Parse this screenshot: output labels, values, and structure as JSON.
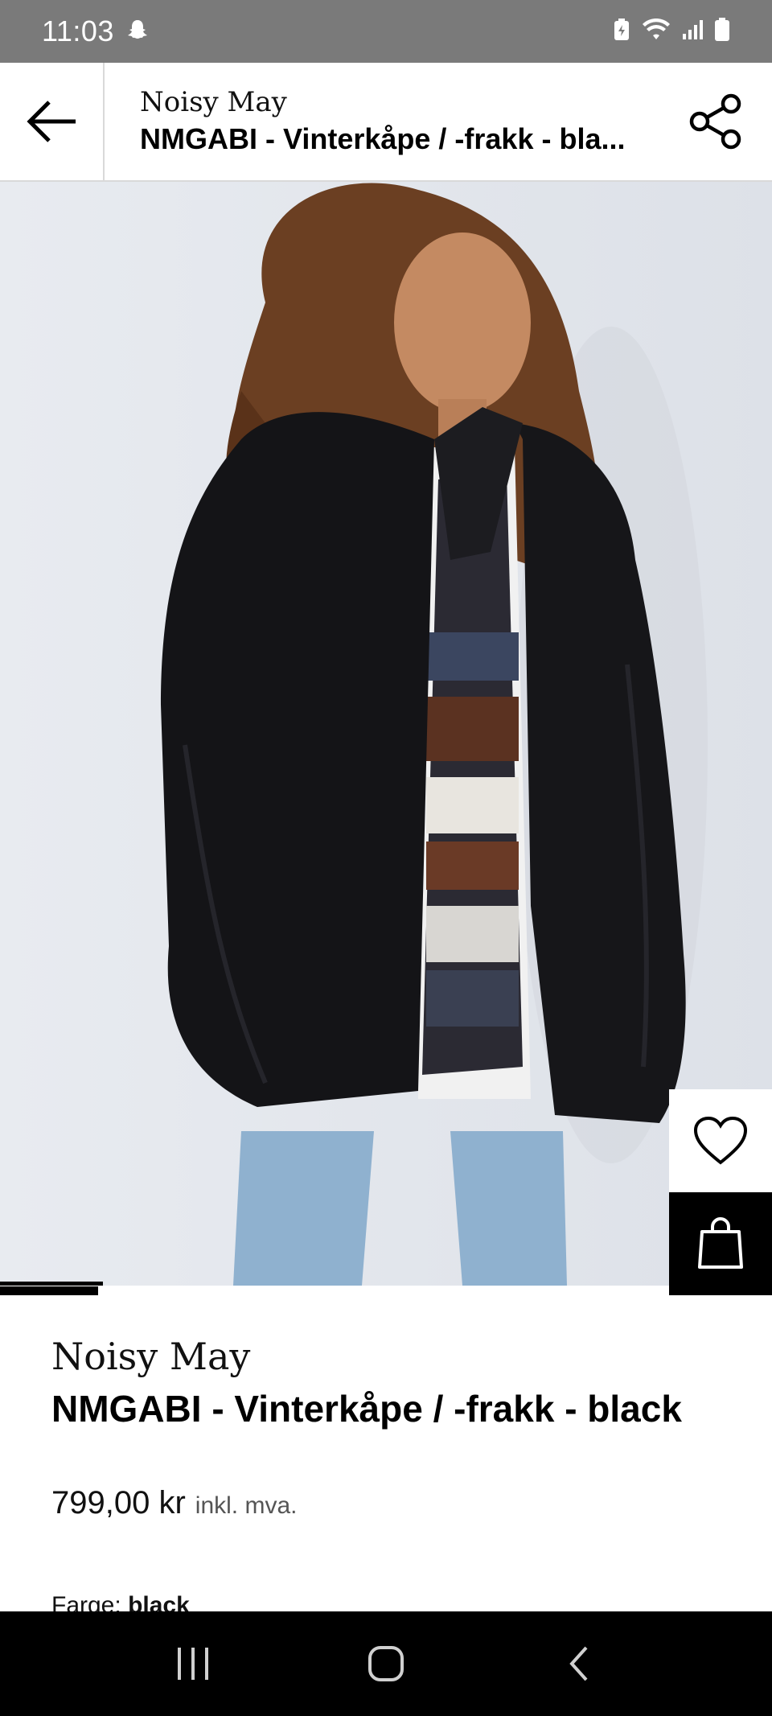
{
  "status_bar": {
    "time": "11:03",
    "icons": [
      "snapchat-icon",
      "battery-saver-icon",
      "wifi-icon",
      "signal-icon",
      "battery-icon"
    ]
  },
  "header": {
    "brand": "Noisy May",
    "product_name": "NMGABI - Vinterkåpe / -frakk - bla...",
    "back_icon": "arrow-left-icon",
    "share_icon": "share-icon"
  },
  "gallery": {
    "current_image": 1,
    "progress": 0.166,
    "actions": {
      "ai_icon": "sparkle-crop-icon",
      "wishlist_icon": "heart-icon",
      "cart_icon": "shopping-bag-icon"
    }
  },
  "product": {
    "brand": "Noisy May",
    "name": "NMGABI - Vinterkåpe / -frakk - black",
    "price": "799,00 kr",
    "vat_note": "inkl. mva.",
    "color_label": "Farge:",
    "color_value": "black"
  },
  "nav_bar": {
    "recents_icon": "recents-icon",
    "home_icon": "home-icon",
    "back_icon": "back-chevron-icon"
  },
  "colors": {
    "status_bar_bg": "#7a7a7a",
    "hero_bg": "#e6e9ee",
    "accent": "#000000"
  }
}
